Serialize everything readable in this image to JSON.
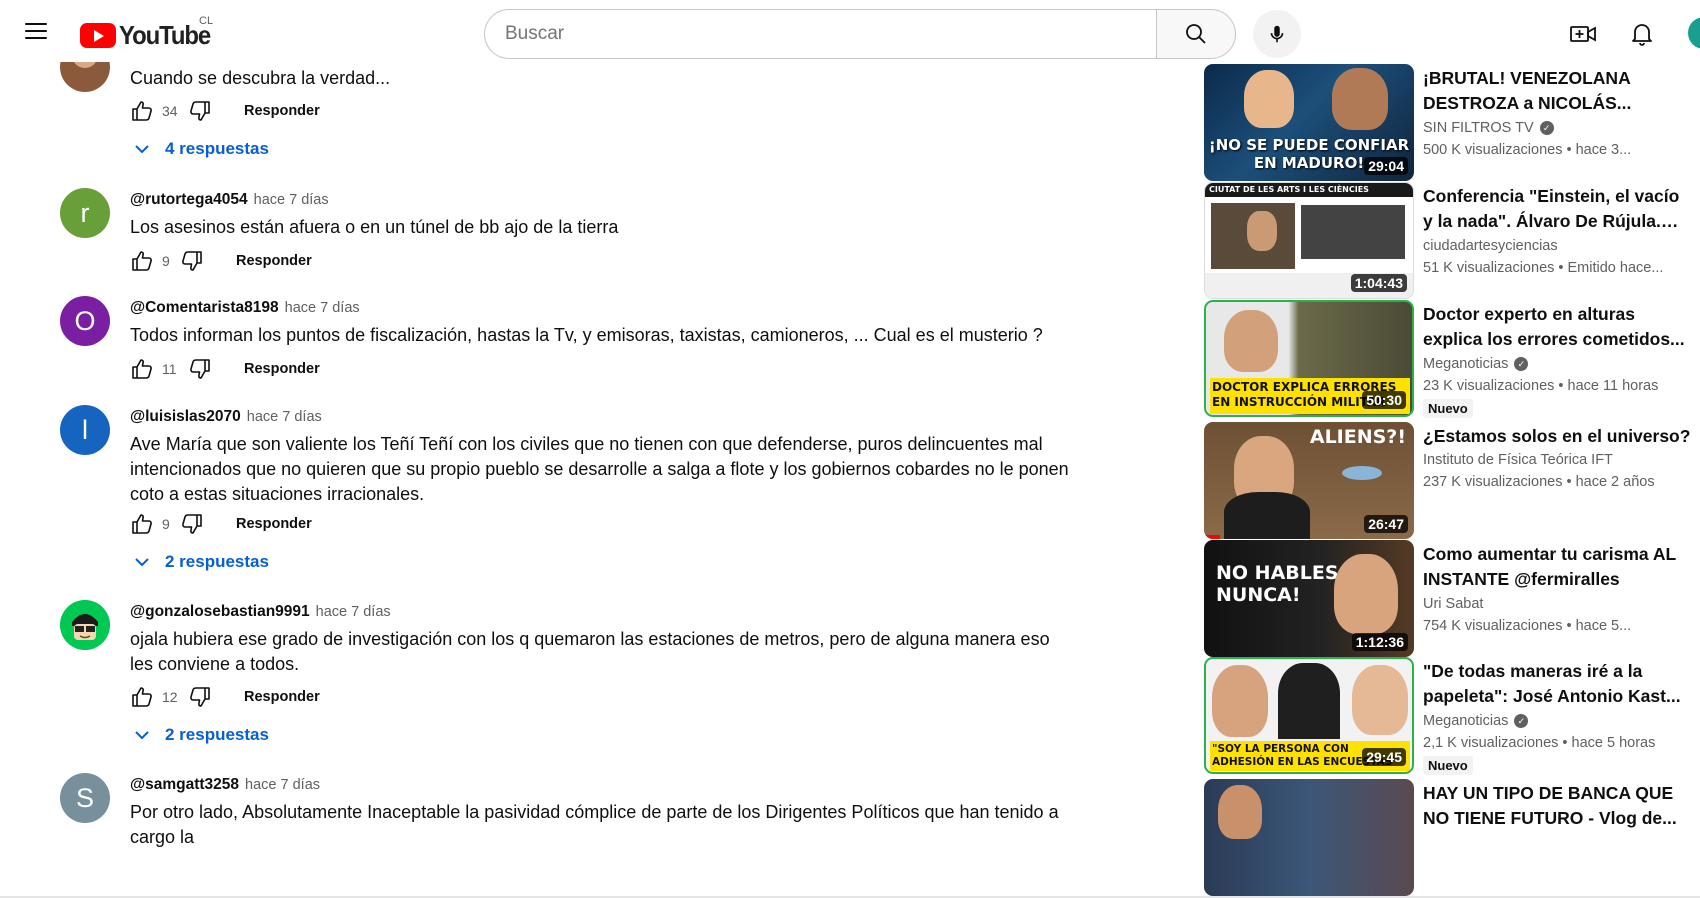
{
  "header": {
    "logo_text": "YouTube",
    "country_code": "CL",
    "search_placeholder": "Buscar"
  },
  "comments": {
    "partial": {
      "text": "Cuando se descubra la verdad...",
      "likes": "34",
      "reply_label": "Responder",
      "replies": "4 respuestas"
    },
    "items": [
      {
        "avatar_letter": "r",
        "avatar_color": "#689f38",
        "handle": "@rutortega4054",
        "time": "hace 7 días",
        "text": "Los asesinos están afuera o en un túnel de bb ajo de la tierra",
        "likes": "9",
        "reply_label": "Responder"
      },
      {
        "avatar_letter": "O",
        "avatar_color": "#7b1fa2",
        "handle": "@Comentarista8198",
        "time": "hace 7 días",
        "text": "Todos informan los puntos de fiscalización, hastas la Tv, y emisoras, taxistas, camioneros, ... Cual es el musterio ?",
        "likes": "11",
        "reply_label": "Responder"
      },
      {
        "avatar_letter": "l",
        "avatar_color": "#1565c0",
        "handle": "@luisislas2070",
        "time": "hace 7 días",
        "text": "Ave María que son valiente los Teñí Teñí con los civiles que no tienen con que defenderse, puros delincuentes mal intencionados que no quieren que su propio pueblo se desarrolle a salga a flote y los gobiernos cobardes no le ponen coto a estas situaciones irracionales.",
        "likes": "9",
        "reply_label": "Responder",
        "replies": "2 respuestas"
      },
      {
        "avatar_letter": "",
        "avatar_color": "#00c853",
        "handle": "@gonzalosebastian9991",
        "time": "hace 7 días",
        "text": "ojala hubiera ese grado de investigación con los q quemaron las estaciones de metros, pero de alguna manera eso les conviene a todos.",
        "likes": "12",
        "reply_label": "Responder",
        "replies": "2 respuestas"
      },
      {
        "avatar_letter": "S",
        "avatar_color": "#78909c",
        "handle": "@samgatt3258",
        "time": "hace 7 días",
        "text": "Por otro lado, Absolutamente Inaceptable la pasividad cómplice de parte de los Dirigentes Políticos que han tenido a cargo la"
      }
    ]
  },
  "sidebar": {
    "videos": [
      {
        "title": "¡BRUTAL! VENEZOLANA DESTROZA a NICOLÁS...",
        "channel": "SIN FILTROS TV",
        "verified": true,
        "meta": "500 K visualizaciones • hace 3...",
        "duration": "29:04",
        "thumb_caption": "¡NO SE PUEDE CONFIAR EN MADURO!"
      },
      {
        "title": "Conferencia \"Einstein, el vacío y la nada\". Álvaro De Rújula. UC...",
        "channel": "ciudadartesyciencias",
        "verified": false,
        "meta": "51 K visualizaciones • Emitido hace...",
        "duration": "1:04:43",
        "thumb_caption": "CIUTAT DE LES ARTS I LES CIÈNCIES"
      },
      {
        "title": "Doctor experto en alturas explica los errores cometidos...",
        "channel": "Meganoticias",
        "verified": true,
        "meta": "23 K visualizaciones • hace 11 horas",
        "badge": "Nuevo",
        "duration": "50:30",
        "thumb_caption": "DOCTOR EXPLICA ERRORES EN INSTRUCCIÓN MILITAR"
      },
      {
        "title": "¿Estamos solos en el universo?",
        "channel": "Instituto de Física Teórica IFT",
        "verified": false,
        "meta": "237 K visualizaciones • hace 2 años",
        "duration": "26:47",
        "thumb_caption": "ALIENS?!"
      },
      {
        "title": "Como aumentar tu carisma AL INSTANTE @fermiralles",
        "channel": "Uri Sabat",
        "verified": false,
        "meta": "754 K visualizaciones • hace 5...",
        "duration": "1:12:36",
        "thumb_caption": "NO HABLES NUNCA!"
      },
      {
        "title": "\"De todas maneras iré a la papeleta\": José Antonio Kast...",
        "channel": "Meganoticias",
        "verified": true,
        "meta": "2,1 K visualizaciones • hace 5 horas",
        "badge": "Nuevo",
        "duration": "29:45",
        "thumb_caption": "\"SOY LA PERSONA CON ADHESIÓN EN LAS ENCUESTAS\""
      },
      {
        "title": "HAY UN TIPO DE BANCA QUE NO TIENE FUTURO - Vlog de...",
        "channel": "",
        "verified": false,
        "meta": "",
        "duration": "",
        "thumb_caption": ""
      }
    ]
  }
}
